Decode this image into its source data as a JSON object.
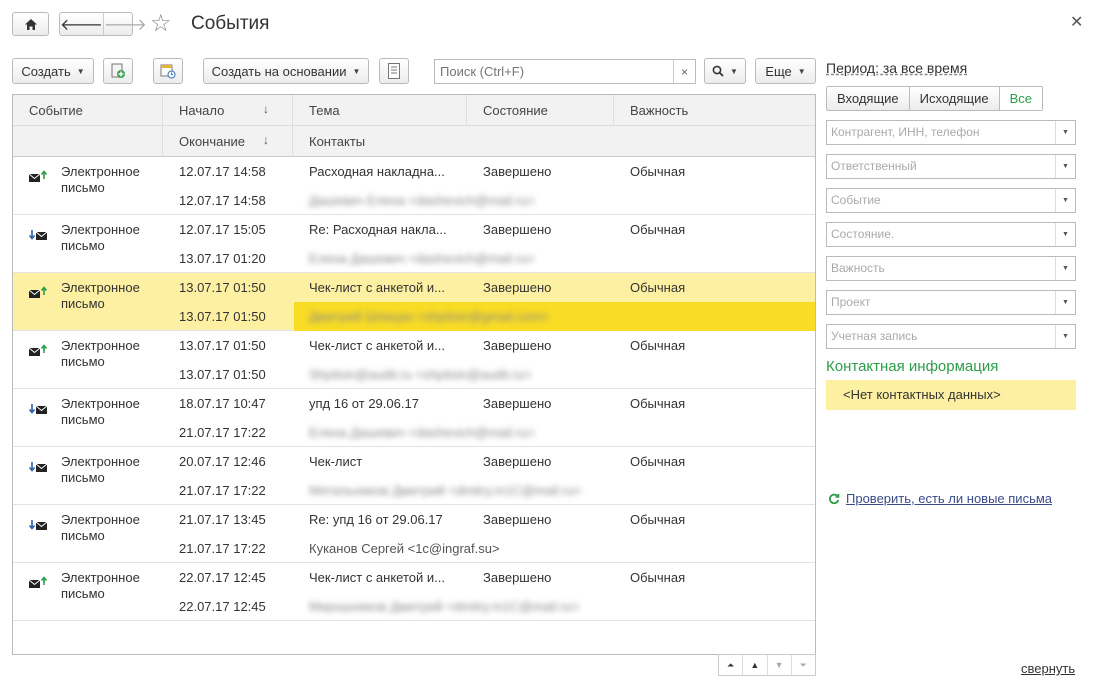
{
  "header": {
    "title": "События",
    "back_glyph": "🡐",
    "forward_glyph": "🡒",
    "star_glyph": "☆",
    "close_glyph": "✕"
  },
  "toolbar": {
    "create_label": "Создать",
    "create_based_label": "Создать на основании",
    "search_placeholder": "Поиск (Ctrl+F)",
    "clear_glyph": "×",
    "more_label": "Еще"
  },
  "grid": {
    "columns_top": [
      "Событие",
      "Начало",
      "Тема",
      "Состояние",
      "Важность"
    ],
    "columns_bottom": [
      "Окончание",
      "Контакты"
    ],
    "rows": [
      {
        "type": "Электронное\nписьмо",
        "direction": "outgoing",
        "start": "12.07.17 14:58",
        "end": "12.07.17 14:58",
        "subject": "Расходная накладна...",
        "contact": "Дашевич Елена <dashevich@mail.ru>",
        "contact_blurred": true,
        "state": "Завершено",
        "importance": "Обычная",
        "selected": false
      },
      {
        "type": "Электронное\nписьмо",
        "direction": "incoming",
        "start": "12.07.17 15:05",
        "end": "13.07.17 01:20",
        "subject": "Re: Расходная накла...",
        "contact": "Елена Дашевич <dashevich@mail.ru>",
        "contact_blurred": true,
        "state": "Завершено",
        "importance": "Обычная",
        "selected": false
      },
      {
        "type": "Электронное\nписьмо",
        "direction": "outgoing",
        "start": "13.07.17 01:50",
        "end": "13.07.17 01:50",
        "subject": "Чек-лист с анкетой и...",
        "contact": "Дмитрий Шпицин <shpitsin@gmail.com>",
        "contact_blurred": true,
        "state": "Завершено",
        "importance": "Обычная",
        "selected": true
      },
      {
        "type": "Электронное\nписьмо",
        "direction": "outgoing",
        "start": "13.07.17 01:50",
        "end": "13.07.17 01:50",
        "subject": "Чек-лист с анкетой и...",
        "contact": "Shpitsin@audit.ru <shpitsin@audit.ru>",
        "contact_blurred": true,
        "state": "Завершено",
        "importance": "Обычная",
        "selected": false
      },
      {
        "type": "Электронное\nписьмо",
        "direction": "incoming",
        "start": "18.07.17 10:47",
        "end": "21.07.17 17:22",
        "subject": "упд 16 от 29.06.17",
        "contact": "Елена Дашевич <dashevich@mail.ru>",
        "contact_blurred": true,
        "state": "Завершено",
        "importance": "Обычная",
        "selected": false
      },
      {
        "type": "Электронное\nписьмо",
        "direction": "incoming",
        "start": "20.07.17 12:46",
        "end": "21.07.17 17:22",
        "subject": "Чек-лист",
        "contact": "Метальников Дмитрий <dmitry.m1C@mail.ru>",
        "contact_blurred": true,
        "state": "Завершено",
        "importance": "Обычная",
        "selected": false
      },
      {
        "type": "Электронное\nписьмо",
        "direction": "incoming",
        "start": "21.07.17 13:45",
        "end": "21.07.17 17:22",
        "subject": "Re: упд 16 от 29.06.17",
        "contact": "Куканов Сергей <1c@ingraf.su>",
        "contact_blurred": false,
        "state": "Завершено",
        "importance": "Обычная",
        "selected": false
      },
      {
        "type": "Электронное\nписьмо",
        "direction": "outgoing",
        "start": "22.07.17 12:45",
        "end": "22.07.17 12:45",
        "subject": "Чек-лист с анкетой и...",
        "contact": "Мирошников Дмитрий <dmitry.m1C@mail.ru>",
        "contact_blurred": true,
        "state": "Завершено",
        "importance": "Обычная",
        "selected": false
      }
    ]
  },
  "grid_nav": [
    "first",
    "prev",
    "next",
    "last"
  ],
  "panel": {
    "period_label": "Период: за все время",
    "tabs": [
      {
        "label": "Входящие",
        "active": false
      },
      {
        "label": "Исходящие",
        "active": false
      },
      {
        "label": "Все",
        "active": true
      }
    ],
    "filters": [
      "Контрагент, ИНН, телефон",
      "Ответственный",
      "Событие",
      "Состояние.",
      "Важность",
      "Проект",
      "Учетная запись"
    ],
    "contact_title": "Контактная информация",
    "contact_empty": "<Нет контактных данных>",
    "check_mail_label": "Проверить, есть ли новые письма",
    "collapse_label": "свернуть"
  },
  "colors": {
    "accent_green": "#2e9d4a",
    "selection_row": "#fdf0a3",
    "selection_cell": "#f9dc25"
  }
}
